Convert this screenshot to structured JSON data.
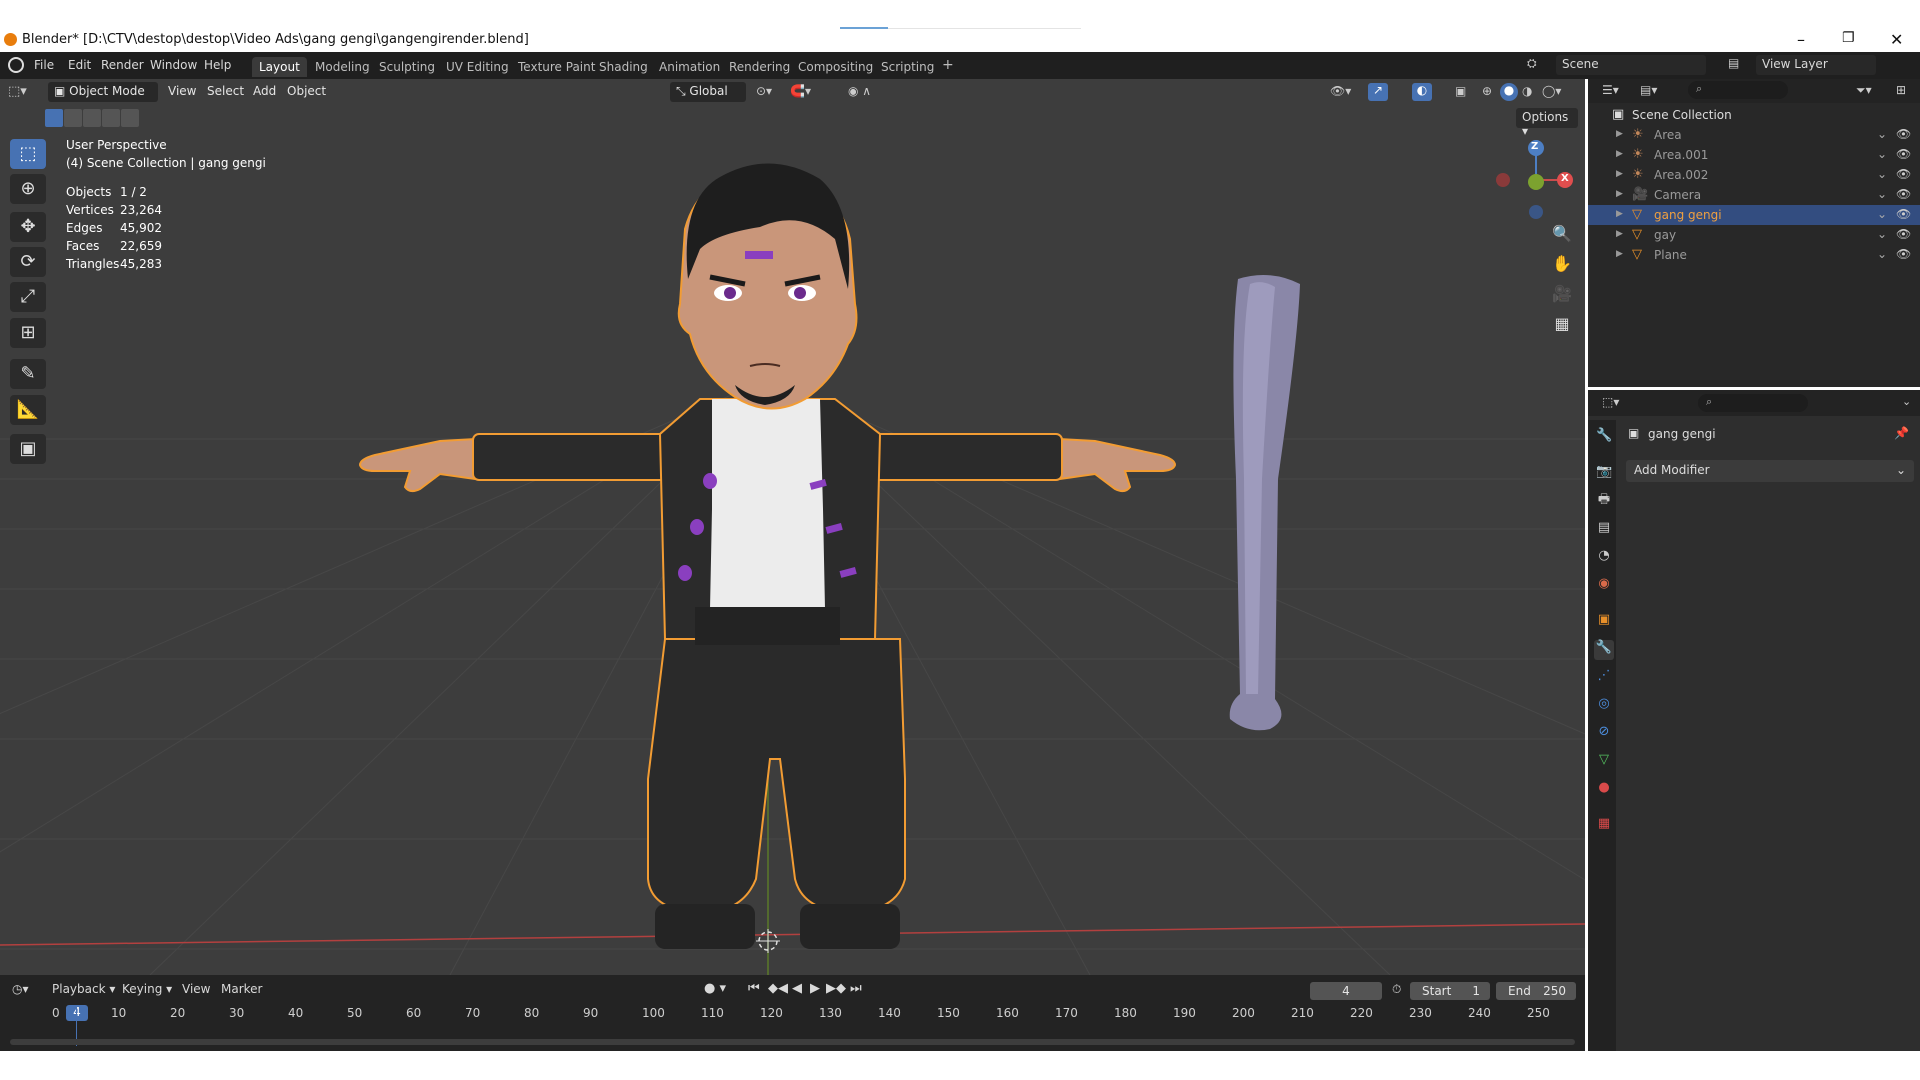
{
  "window": {
    "title": "Blender* [D:\\CTV\\destop\\destop\\Video Ads\\gang gengi\\gangengirender.blend]",
    "minimize": "–",
    "restore": "❐",
    "close": "✕"
  },
  "menubar": {
    "items": [
      "File",
      "Edit",
      "Render",
      "Window",
      "Help"
    ],
    "workspaces": [
      "Layout",
      "Modeling",
      "Sculpting",
      "UV Editing",
      "Texture Paint",
      "Shading",
      "Animation",
      "Rendering",
      "Compositing",
      "Scripting"
    ],
    "active_workspace": "Layout",
    "add_tab": "+",
    "scene_label": "Scene",
    "view_layer_label": "View Layer"
  },
  "viewport_header": {
    "mode": "Object Mode",
    "menus": [
      "View",
      "Select",
      "Add",
      "Object"
    ],
    "transform_orientation": "Global",
    "options": "Options"
  },
  "viewport_overlay": {
    "perspective": "User Perspective",
    "collection": "(4) Scene Collection | gang gengi",
    "stats": [
      {
        "label": "Objects",
        "value": "1 / 2"
      },
      {
        "label": "Vertices",
        "value": "23,264"
      },
      {
        "label": "Edges",
        "value": "45,902"
      },
      {
        "label": "Faces",
        "value": "22,659"
      },
      {
        "label": "Triangles",
        "value": "45,283"
      }
    ],
    "gizmo": {
      "z": "Z",
      "x": "X"
    }
  },
  "timeline": {
    "menus": [
      "Playback",
      "Keying",
      "View",
      "Marker"
    ],
    "current_frame": "4",
    "start_label": "Start",
    "start_value": "1",
    "end_label": "End",
    "end_value": "250",
    "ticks": [
      "0",
      "10",
      "20",
      "30",
      "40",
      "50",
      "60",
      "70",
      "80",
      "90",
      "100",
      "110",
      "120",
      "130",
      "140",
      "150",
      "160",
      "170",
      "180",
      "190",
      "200",
      "210",
      "220",
      "230",
      "240",
      "250"
    ]
  },
  "outliner": {
    "root": "Scene Collection",
    "items": [
      {
        "name": "Area",
        "icon": "light-icon",
        "selected": false
      },
      {
        "name": "Area.001",
        "icon": "light-icon",
        "selected": false
      },
      {
        "name": "Area.002",
        "icon": "light-icon",
        "selected": false
      },
      {
        "name": "Camera",
        "icon": "camera-icon",
        "selected": false
      },
      {
        "name": "gang gengi",
        "icon": "mesh-icon",
        "selected": true
      },
      {
        "name": "gay",
        "icon": "mesh-icon",
        "selected": false
      },
      {
        "name": "Plane",
        "icon": "mesh-icon",
        "selected": false
      }
    ]
  },
  "properties": {
    "object_name": "gang gengi",
    "add_modifier": "Add Modifier"
  },
  "colors": {
    "selection_orange": "#f29c33",
    "active_blue": "#4772b3",
    "grid_bg": "#3e3e3e",
    "x_axis": "#b3403f",
    "y_axis": "#6a8f2e"
  }
}
